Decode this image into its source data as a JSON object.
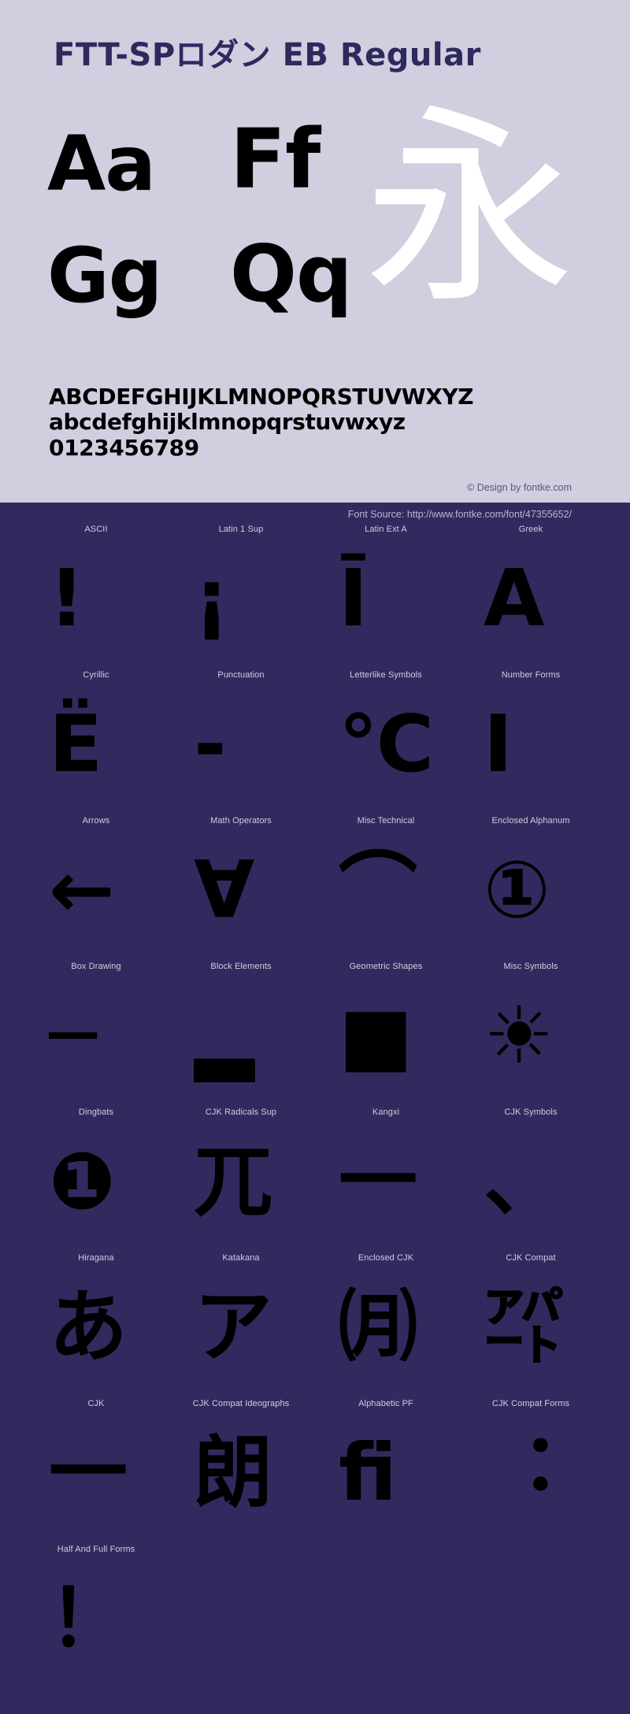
{
  "colors": {
    "top_background": "#d0cedf",
    "bottom_background": "#322a5e",
    "title": "#2e2a5e",
    "glyph": "#000000",
    "cjk_showcase_glyph": "#ffffff",
    "label": "#cfccdf",
    "copyright": "#5b5870"
  },
  "header": {
    "title": "FTT-SPロダン EB Regular"
  },
  "showcase": {
    "pair_1": "Aa",
    "pair_2": "Ff",
    "pair_3": "Gg",
    "pair_4": "Qq",
    "cjk_sample": "永"
  },
  "alphabet": {
    "uppercase": "ABCDEFGHIJKLMNOPQRSTUVWXYZ",
    "lowercase": "abcdefghijklmnopqrstuvwxyz",
    "digits": "0123456789"
  },
  "credits": {
    "copyright": "© Design by fontke.com",
    "font_source": "Font Source: http://www.fontke.com/font/47355652/"
  },
  "unicode_blocks": {
    "rows": [
      [
        {
          "label": "ASCII",
          "glyph": "!",
          "size": "normal"
        },
        {
          "label": "Latin 1 Sup",
          "glyph": "¡",
          "size": "normal"
        },
        {
          "label": "Latin Ext A",
          "glyph": "Ī",
          "size": "normal"
        },
        {
          "label": "Greek",
          "glyph": "Α",
          "size": "normal"
        }
      ],
      [
        {
          "label": "Cyrillic",
          "glyph": "Ё",
          "size": "normal"
        },
        {
          "label": "Punctuation",
          "glyph": "‐",
          "size": "normal"
        },
        {
          "label": "Letterlike Symbols",
          "glyph": "℃",
          "size": "normal"
        },
        {
          "label": "Number Forms",
          "glyph": "Ⅰ",
          "size": "normal"
        }
      ],
      [
        {
          "label": "Arrows",
          "glyph": "←",
          "size": "normal"
        },
        {
          "label": "Math Operators",
          "glyph": "∀",
          "size": "normal"
        },
        {
          "label": "Misc Technical",
          "glyph": "⌒",
          "size": "normal"
        },
        {
          "label": "Enclosed Alphanum",
          "glyph": "①",
          "size": "normal"
        }
      ],
      [
        {
          "label": "Box Drawing",
          "glyph": "─",
          "size": "normal"
        },
        {
          "label": "Block Elements",
          "glyph": "▂",
          "size": "normal"
        },
        {
          "label": "Geometric Shapes",
          "glyph": "■",
          "size": "normal"
        },
        {
          "label": "Misc Symbols",
          "glyph": "☀",
          "size": "normal"
        }
      ],
      [
        {
          "label": "Dingbats",
          "glyph": "❶",
          "size": "normal"
        },
        {
          "label": "CJK Radicals Sup",
          "glyph": "兀",
          "size": "normal"
        },
        {
          "label": "Kangxi",
          "glyph": "一",
          "size": "normal"
        },
        {
          "label": "CJK Symbols",
          "glyph": "、",
          "size": "normal"
        }
      ],
      [
        {
          "label": "Hiragana",
          "glyph": "あ",
          "size": "normal"
        },
        {
          "label": "Katakana",
          "glyph": "ア",
          "size": "normal"
        },
        {
          "label": "Enclosed CJK",
          "glyph": "㈪",
          "size": "normal"
        },
        {
          "label": "CJK Compat",
          "glyph": "㌀",
          "size": "normal"
        }
      ],
      [
        {
          "label": "CJK",
          "glyph": "一",
          "size": "normal"
        },
        {
          "label": "CJK Compat Ideographs",
          "glyph": "朗",
          "size": "normal"
        },
        {
          "label": "Alphabetic PF",
          "glyph": "ﬁ",
          "size": "normal"
        },
        {
          "label": "CJK Compat Forms",
          "glyph": "︓",
          "size": "normal"
        }
      ],
      [
        {
          "label": "Half And Full Forms",
          "glyph": "！",
          "size": "normal"
        }
      ]
    ]
  }
}
